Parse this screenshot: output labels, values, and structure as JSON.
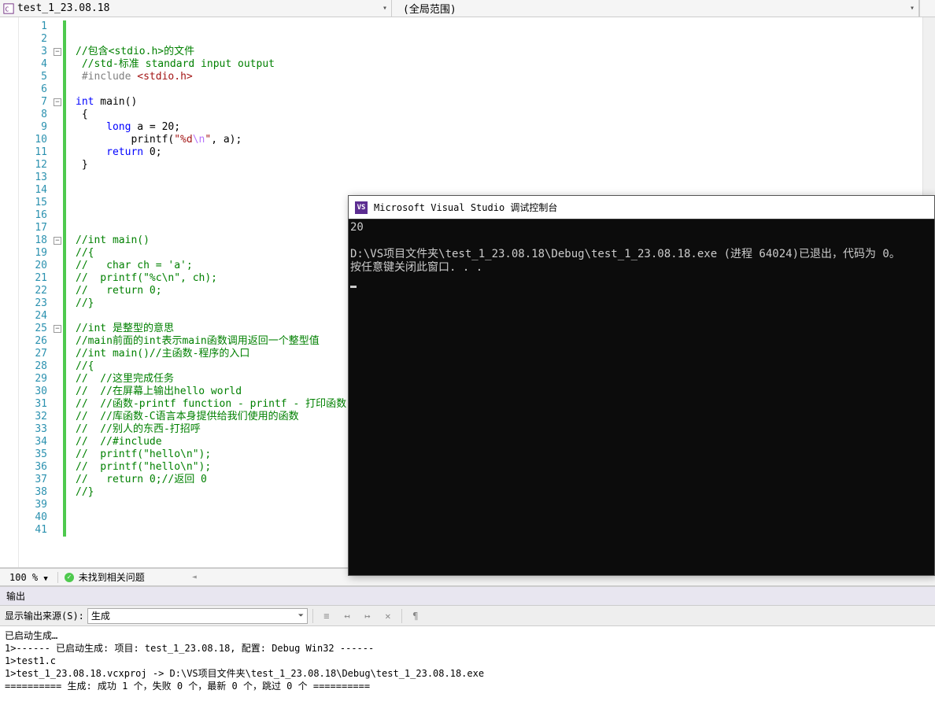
{
  "topbar": {
    "file_label": "test_1_23.08.18",
    "scope_label": "(全局范围)"
  },
  "code_lines": [
    {
      "n": 1,
      "html": ""
    },
    {
      "n": 2,
      "html": ""
    },
    {
      "n": 3,
      "html": "<span class='c-comment'>//包含&lt;stdio.h&gt;的文件</span>",
      "fold": true
    },
    {
      "n": 4,
      "html": " <span class='c-comment'>//std-标准 standard input output</span>"
    },
    {
      "n": 5,
      "html": " <span class='c-inc'>#include</span> <span class='c-incfile'>&lt;stdio.h&gt;</span>"
    },
    {
      "n": 6,
      "html": ""
    },
    {
      "n": 7,
      "html": "<span class='c-type'>int</span> main()",
      "fold": true
    },
    {
      "n": 8,
      "html": " {"
    },
    {
      "n": 9,
      "html": "     <span class='c-type'>long</span> a = 20;"
    },
    {
      "n": 10,
      "html": "         printf(<span class='c-string'>\"%d</span><span class='c-escape'>\\n</span><span class='c-string'>\"</span>, a);"
    },
    {
      "n": 11,
      "html": "     <span class='c-keyword'>return</span> 0;"
    },
    {
      "n": 12,
      "html": " }"
    },
    {
      "n": 13,
      "html": ""
    },
    {
      "n": 14,
      "html": ""
    },
    {
      "n": 15,
      "html": ""
    },
    {
      "n": 16,
      "html": ""
    },
    {
      "n": 17,
      "html": ""
    },
    {
      "n": 18,
      "html": "<span class='c-comment'>//int main()</span>",
      "fold": true
    },
    {
      "n": 19,
      "html": "<span class='c-comment'>//{</span>"
    },
    {
      "n": 20,
      "html": "<span class='c-comment'>//   char ch = 'a';</span>"
    },
    {
      "n": 21,
      "html": "<span class='c-comment'>//  printf(\"%c\\n\", ch);</span>"
    },
    {
      "n": 22,
      "html": "<span class='c-comment'>//   return 0;</span>"
    },
    {
      "n": 23,
      "html": "<span class='c-comment'>//}</span>"
    },
    {
      "n": 24,
      "html": ""
    },
    {
      "n": 25,
      "html": "<span class='c-comment'>//int 是整型的意思</span>",
      "fold": true
    },
    {
      "n": 26,
      "html": "<span class='c-comment'>//main前面的int表示main函数调用返回一个整型值</span>"
    },
    {
      "n": 27,
      "html": "<span class='c-comment'>//int main()//主函数-程序的入口</span>"
    },
    {
      "n": 28,
      "html": "<span class='c-comment'>//{</span>"
    },
    {
      "n": 29,
      "html": "<span class='c-comment'>//  //这里完成任务</span>"
    },
    {
      "n": 30,
      "html": "<span class='c-comment'>//  //在屏幕上输出hello world</span>"
    },
    {
      "n": 31,
      "html": "<span class='c-comment'>//  //函数-printf function - printf - 打印函数</span>"
    },
    {
      "n": 32,
      "html": "<span class='c-comment'>//  //库函数-C语言本身提供给我们使用的函数</span>"
    },
    {
      "n": 33,
      "html": "<span class='c-comment'>//  //别人的东西-打招呼</span>"
    },
    {
      "n": 34,
      "html": "<span class='c-comment'>//  //#include</span>"
    },
    {
      "n": 35,
      "html": "<span class='c-comment'>//  printf(\"hello\\n\");</span>"
    },
    {
      "n": 36,
      "html": "<span class='c-comment'>//  printf(\"hello\\n\");</span>"
    },
    {
      "n": 37,
      "html": "<span class='c-comment'>//   return 0;//返回 0</span>"
    },
    {
      "n": 38,
      "html": "<span class='c-comment'>//}</span>"
    },
    {
      "n": 39,
      "html": ""
    },
    {
      "n": 40,
      "html": ""
    },
    {
      "n": 41,
      "html": ""
    }
  ],
  "status": {
    "zoom": "100 %",
    "msg": "未找到相关问题"
  },
  "output": {
    "title": "输出",
    "source_label": "显示输出来源(S):",
    "source_value": "生成",
    "lines": [
      "已启动生成…",
      "1>------ 已启动生成: 项目: test_1_23.08.18, 配置: Debug Win32 ------",
      "1>test1.c",
      "1>test_1_23.08.18.vcxproj -> D:\\VS项目文件夹\\test_1_23.08.18\\Debug\\test_1_23.08.18.exe",
      "========== 生成: 成功 1 个，失败 0 个，最新 0 个，跳过 0 个 =========="
    ]
  },
  "console": {
    "title": "Microsoft Visual Studio 调试控制台",
    "body": "20\n\nD:\\VS项目文件夹\\test_1_23.08.18\\Debug\\test_1_23.08.18.exe (进程 64024)已退出，代码为 0。\n按任意键关闭此窗口. . ."
  }
}
